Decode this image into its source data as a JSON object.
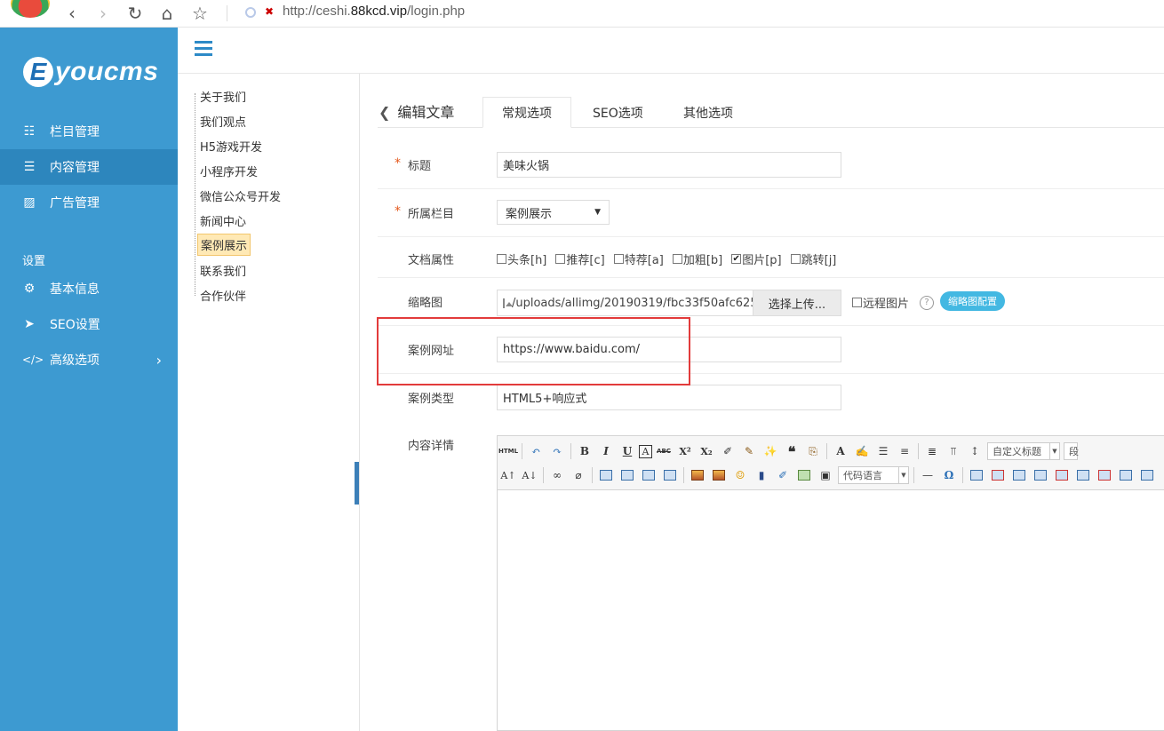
{
  "browser": {
    "url_prefix": "http://ceshi.",
    "url_domain": "88kcd.vip",
    "url_suffix": "/login.php"
  },
  "sidebar": {
    "logo_letter": "E",
    "logo_text": "youcms",
    "items": [
      {
        "label": "栏目管理",
        "icon": "sitemap-icon"
      },
      {
        "label": "内容管理",
        "icon": "list-icon",
        "active": true
      },
      {
        "label": "广告管理",
        "icon": "image-icon"
      }
    ],
    "section_label": "设置",
    "settings": [
      {
        "label": "基本信息",
        "icon": "gear-icon"
      },
      {
        "label": "SEO设置",
        "icon": "paper-plane-icon"
      },
      {
        "label": "高级选项",
        "icon": "code-icon"
      }
    ]
  },
  "tree": {
    "items": [
      "关于我们",
      "我们观点",
      "H5游戏开发",
      "小程序开发",
      "微信公众号开发",
      "新闻中心",
      "案例展示",
      "联系我们",
      "合作伙伴"
    ],
    "selected": "案例展示"
  },
  "page": {
    "back_label": "编辑文章",
    "tabs": [
      "常规选项",
      "SEO选项",
      "其他选项"
    ],
    "active_tab": "常规选项"
  },
  "form": {
    "title": {
      "label": "标题",
      "value": "美味火锅",
      "required": "*"
    },
    "category": {
      "label": "所属栏目",
      "value": "案例展示",
      "required": "*"
    },
    "attributes": {
      "label": "文档属性",
      "options": [
        {
          "label": "头条[h]",
          "checked": false
        },
        {
          "label": "推荐[c]",
          "checked": false
        },
        {
          "label": "特荐[a]",
          "checked": false
        },
        {
          "label": "加粗[b]",
          "checked": false
        },
        {
          "label": "图片[p]",
          "checked": true
        },
        {
          "label": "跳转[j]",
          "checked": false
        }
      ]
    },
    "thumbnail": {
      "label": "缩略图",
      "path": "/uploads/allimg/20190319/fbc33f50afc625",
      "upload_label": "选择上传...",
      "remote_label": "远程图片",
      "help": "?",
      "config_label": "缩略图配置"
    },
    "case_url": {
      "label": "案例网址",
      "value": "https://www.baidu.com/"
    },
    "case_type": {
      "label": "案例类型",
      "value": "HTML5+响应式"
    },
    "content": {
      "label": "内容详情",
      "custom_title_placeholder": "自定义标题",
      "code_language_placeholder": "代码语言"
    }
  },
  "toolbar_glyphs": {
    "html": "HTML",
    "bold": "B",
    "italic": "I",
    "underline": "U",
    "border": "A",
    "strike": "ABC",
    "superscript": "X²",
    "subscript": "X₂",
    "quote": "❝",
    "fontcolor": "A",
    "omega": "Ω",
    "hr": "—",
    "paragraph_short": "段"
  }
}
